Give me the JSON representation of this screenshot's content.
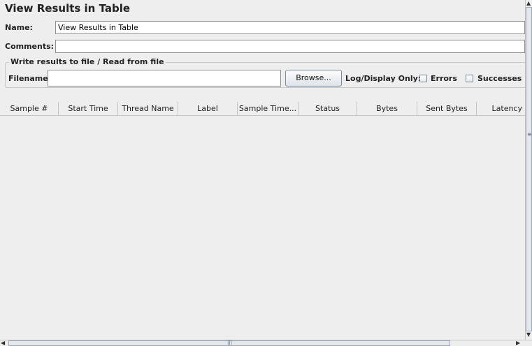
{
  "panel": {
    "title": "View Results in Table"
  },
  "name_field": {
    "label": "Name:",
    "value": "View Results in Table"
  },
  "comments_field": {
    "label": "Comments:",
    "value": ""
  },
  "file_group": {
    "legend": "Write results to file / Read from file",
    "filename_label": "Filename",
    "filename_value": "",
    "browse_label": "Browse...",
    "log_label": "Log/Display Only:",
    "errors_label": "Errors",
    "successes_label": "Successes"
  },
  "table": {
    "columns": [
      "Sample #",
      "Start Time",
      "Thread Name",
      "Label",
      "Sample Time...",
      "Status",
      "Bytes",
      "Sent Bytes",
      "Latency"
    ]
  },
  "icons": {
    "scroll_up": "triangle-up-icon",
    "scroll_down": "triangle-down-icon",
    "scroll_left": "triangle-left-icon",
    "scroll_right": "triangle-right-icon"
  }
}
